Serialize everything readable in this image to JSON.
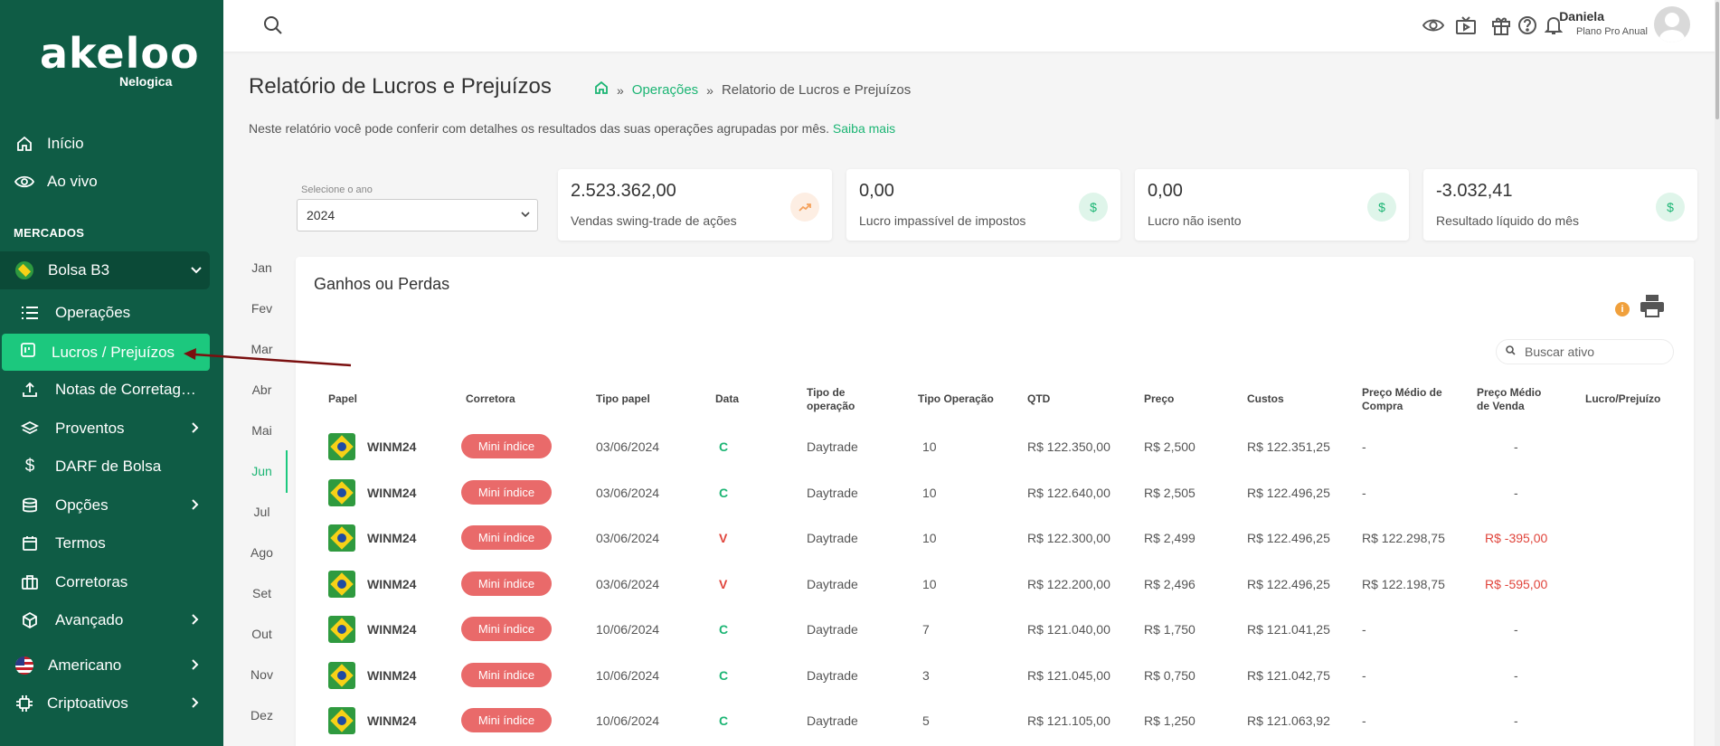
{
  "brand": {
    "name": "akeloo",
    "sub": "Nelogica"
  },
  "sidebar": {
    "top_items": [
      {
        "label": "Início",
        "icon": "home-icon"
      },
      {
        "label": "Ao vivo",
        "icon": "eye-icon"
      }
    ],
    "section_label": "MERCADOS",
    "market": {
      "label": "Bolsa B3",
      "icon": "brazil-flag-icon"
    },
    "sub_items": [
      {
        "label": "Operações",
        "icon": "list-icon"
      },
      {
        "label": "Lucros / Prejuízos",
        "icon": "report-icon",
        "active": true
      },
      {
        "label": "Notas de Corretag…",
        "icon": "upload-icon"
      },
      {
        "label": "Proventos",
        "icon": "layers-icon"
      },
      {
        "label": "DARF de Bolsa",
        "icon": "dollar-icon"
      },
      {
        "label": "Opções",
        "icon": "database-icon"
      },
      {
        "label": "Termos",
        "icon": "calendar-icon"
      },
      {
        "label": "Corretoras",
        "icon": "briefcase-icon"
      },
      {
        "label": "Avançado",
        "icon": "cube-icon"
      }
    ],
    "bottom_items": [
      {
        "label": "Americano",
        "icon": "usa-flag-icon"
      },
      {
        "label": "Criptoativos",
        "icon": "chip-icon"
      }
    ]
  },
  "topbar": {
    "user_name": "Daniela",
    "user_plan": "Plano Pro Anual"
  },
  "header": {
    "title": "Relatório de Lucros e Prejuízos",
    "breadcrumb_link": "Operações",
    "breadcrumb_current": "Relatorio de Lucros e Prejuízos",
    "description": "Neste relatório você pode conferir com detalhes os resultados das suas operações agrupadas por mês.",
    "learn_more": "Saiba mais"
  },
  "filters": {
    "year_label": "Selecione o ano",
    "year_value": "2024"
  },
  "cards": [
    {
      "value": "2.523.362,00",
      "label": "Vendas swing-trade de ações",
      "icon": "trending-up-icon",
      "accent": "#f5a25d"
    },
    {
      "value": "0,00",
      "label": "Lucro impassível de impostos",
      "icon": "dollar-icon",
      "accent": "#1cb574"
    },
    {
      "value": "0,00",
      "label": "Lucro não isento",
      "icon": "dollar-icon",
      "accent": "#1cb574"
    },
    {
      "value": "-3.032,41",
      "label": "Resultado líquido do mês",
      "icon": "dollar-icon",
      "accent": "#1cb574"
    }
  ],
  "months": [
    "Jan",
    "Fev",
    "Mar",
    "Abr",
    "Mai",
    "Jun",
    "Jul",
    "Ago",
    "Set",
    "Out",
    "Nov",
    "Dez"
  ],
  "active_month": "Jun",
  "panel": {
    "title": "Ganhos ou Perdas",
    "search_placeholder": "Buscar ativo"
  },
  "table": {
    "headers": {
      "papel": "Papel",
      "corretora": "Corretora",
      "tipo_papel": "Tipo papel",
      "data": "Data",
      "tipo_operacao_1": "Tipo de",
      "tipo_operacao_2": "operação",
      "tipo_op": "Tipo Operação",
      "qtd": "QTD",
      "preco": "Preço",
      "custos": "Custos",
      "pm_compra_1": "Preço Médio de",
      "pm_compra_2": "Compra",
      "pm_venda_1": "Preço Médio",
      "pm_venda_2": "de Venda",
      "lucro": "Lucro/Prejuízo"
    },
    "rows": [
      {
        "papel": "WINM24",
        "corretora": "Mini índice",
        "tipo_papel": "03/06/2024",
        "data": "C",
        "tipo_operacao": "Daytrade",
        "tipo_op": "10",
        "qtd": "R$ 122.350,00",
        "preco": "R$ 2,500",
        "custos": "R$ 122.351,25",
        "pm_compra": "-",
        "pm_venda": "-",
        "lucro": ""
      },
      {
        "papel": "WINM24",
        "corretora": "Mini índice",
        "tipo_papel": "03/06/2024",
        "data": "C",
        "tipo_operacao": "Daytrade",
        "tipo_op": "10",
        "qtd": "R$ 122.640,00",
        "preco": "R$ 2,505",
        "custos": "R$ 122.496,25",
        "pm_compra": "-",
        "pm_venda": "-",
        "lucro": ""
      },
      {
        "papel": "WINM24",
        "corretora": "Mini índice",
        "tipo_papel": "03/06/2024",
        "data": "V",
        "tipo_operacao": "Daytrade",
        "tipo_op": "10",
        "qtd": "R$ 122.300,00",
        "preco": "R$ 2,499",
        "custos": "R$ 122.496,25",
        "pm_compra": "R$ 122.298,75",
        "pm_venda": "R$ -395,00",
        "lucro": ""
      },
      {
        "papel": "WINM24",
        "corretora": "Mini índice",
        "tipo_papel": "03/06/2024",
        "data": "V",
        "tipo_operacao": "Daytrade",
        "tipo_op": "10",
        "qtd": "R$ 122.200,00",
        "preco": "R$ 2,496",
        "custos": "R$ 122.496,25",
        "pm_compra": "R$ 122.198,75",
        "pm_venda": "R$ -595,00",
        "lucro": ""
      },
      {
        "papel": "WINM24",
        "corretora": "Mini índice",
        "tipo_papel": "10/06/2024",
        "data": "C",
        "tipo_operacao": "Daytrade",
        "tipo_op": "7",
        "qtd": "R$ 121.040,00",
        "preco": "R$ 1,750",
        "custos": "R$ 121.041,25",
        "pm_compra": "-",
        "pm_venda": "-",
        "lucro": ""
      },
      {
        "papel": "WINM24",
        "corretora": "Mini índice",
        "tipo_papel": "10/06/2024",
        "data": "C",
        "tipo_operacao": "Daytrade",
        "tipo_op": "3",
        "qtd": "R$ 121.045,00",
        "preco": "R$ 0,750",
        "custos": "R$ 121.042,75",
        "pm_compra": "-",
        "pm_venda": "-",
        "lucro": ""
      },
      {
        "papel": "WINM24",
        "corretora": "Mini índice",
        "tipo_papel": "10/06/2024",
        "data": "C",
        "tipo_operacao": "Daytrade",
        "tipo_op": "5",
        "qtd": "R$ 121.105,00",
        "preco": "R$ 1,250",
        "custos": "R$ 121.063,92",
        "pm_compra": "-",
        "pm_venda": "-",
        "lucro": ""
      }
    ]
  }
}
